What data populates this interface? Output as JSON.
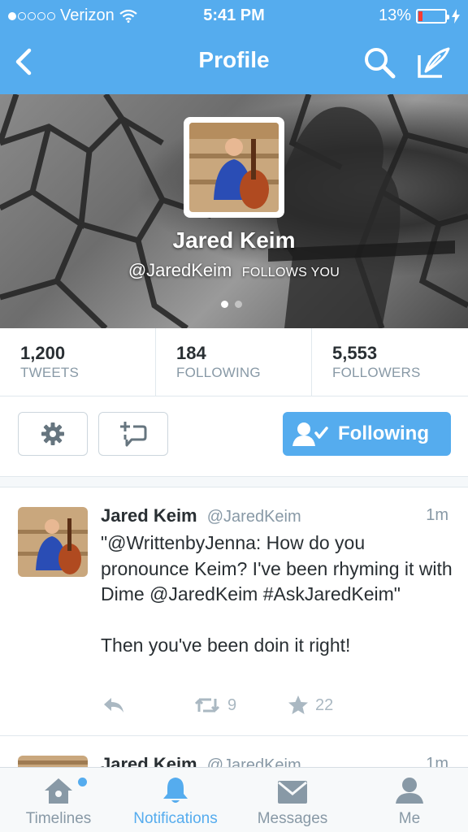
{
  "status_bar": {
    "carrier": "Verizon",
    "time": "5:41 PM",
    "battery": "13%"
  },
  "nav": {
    "title": "Profile",
    "icons": [
      "back-arrow-icon",
      "search-icon",
      "compose-icon"
    ]
  },
  "profile": {
    "name": "Jared Keim",
    "handle": "@JaredKeim",
    "follows_you": "FOLLOWS YOU"
  },
  "stats": [
    {
      "value": "1,200",
      "label": "TWEETS"
    },
    {
      "value": "184",
      "label": "FOLLOWING"
    },
    {
      "value": "5,553",
      "label": "FOLLOWERS"
    }
  ],
  "actions": {
    "follow_label": "Following",
    "icons": [
      "gear-icon",
      "direct-message-icon",
      "follow-user-icon"
    ]
  },
  "tweets": [
    {
      "name": "Jared Keim",
      "handle": "@JaredKeim",
      "time": "1m",
      "text": "\"@WrittenbyJenna: How do you pronounce Keim? I've been rhyming it with Dime @JaredKeim #AskJaredKeim\"\n\nThen you've been doin it right!",
      "retweets": "9",
      "favorites": "22"
    },
    {
      "name": "Jared Keim",
      "handle": "@JaredKeim",
      "time": "1m"
    }
  ],
  "tabs": [
    {
      "label": "Timelines",
      "icon": "home-icon"
    },
    {
      "label": "Notifications",
      "icon": "bell-icon"
    },
    {
      "label": "Messages",
      "icon": "envelope-icon"
    },
    {
      "label": "Me",
      "icon": "person-icon"
    }
  ],
  "colors": {
    "brand": "#55acee",
    "muted_text": "#8899a6",
    "border": "#e1e8ed",
    "battery_low": "#ff3b30"
  }
}
